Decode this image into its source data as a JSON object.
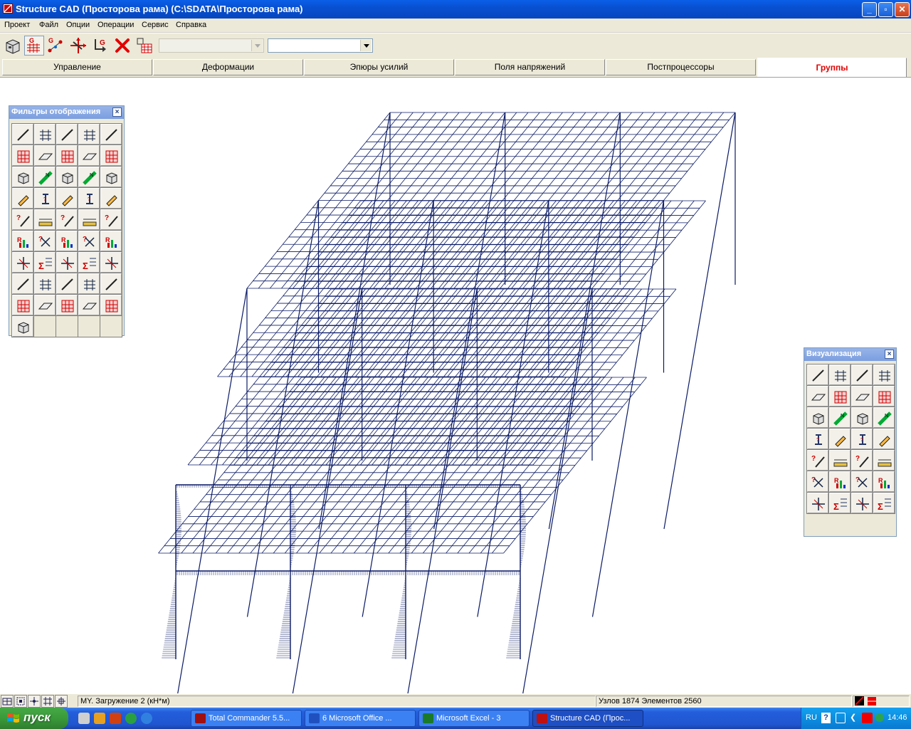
{
  "window": {
    "title": "Structure CAD (Просторова рама) (C:\\SDATA\\Просторова рама)",
    "min_label": "_",
    "max_label": "▫",
    "close_label": "✕"
  },
  "menu": [
    "Проект",
    "Файл",
    "Опции",
    "Операции",
    "Сервис",
    "Справка"
  ],
  "toolbar": {
    "buttons": [
      "view-3d-icon",
      "grid-g-icon",
      "nodes-g-icon",
      "move-node-icon",
      "export-g-icon",
      "delete-icon",
      "table-icon"
    ],
    "combo1_value": "",
    "combo2_value": ""
  },
  "tabs": [
    {
      "label": "Управление",
      "active": false
    },
    {
      "label": "Деформации",
      "active": false
    },
    {
      "label": "Эпюры усилий",
      "active": false
    },
    {
      "label": "Поля напряжений",
      "active": false
    },
    {
      "label": "Постпроцессоры",
      "active": false
    },
    {
      "label": "Группы",
      "active": true
    }
  ],
  "filters_palette": {
    "title": "Фильтры отображения",
    "close_label": "×",
    "rows": 10,
    "cols": 5,
    "icon_count": 46
  },
  "visual_palette": {
    "title": "Визуализация",
    "close_label": "×",
    "rows": 7,
    "cols": 4,
    "icon_count": 28
  },
  "statusbar": {
    "load_label": "MY. Загружение 2   (кН*м)",
    "stats_label": "Узлов 1874 Элементов 2560"
  },
  "taskbar": {
    "start_label": "пуск",
    "tasks": [
      {
        "label": "Total Commander 5.5...",
        "color": "#a01010"
      },
      {
        "label": "6 Microsoft Office ...",
        "color": "#2050c0"
      },
      {
        "label": "Microsoft Excel - 3",
        "color": "#1a7a2a"
      },
      {
        "label": "Structure CAD (Прос...",
        "color": "#c01010"
      }
    ],
    "lang": "RU",
    "clock": "14:46"
  },
  "colors": {
    "frame_line": "#0a1a66",
    "active_tab": "#e00000",
    "accent": "#245edb"
  }
}
